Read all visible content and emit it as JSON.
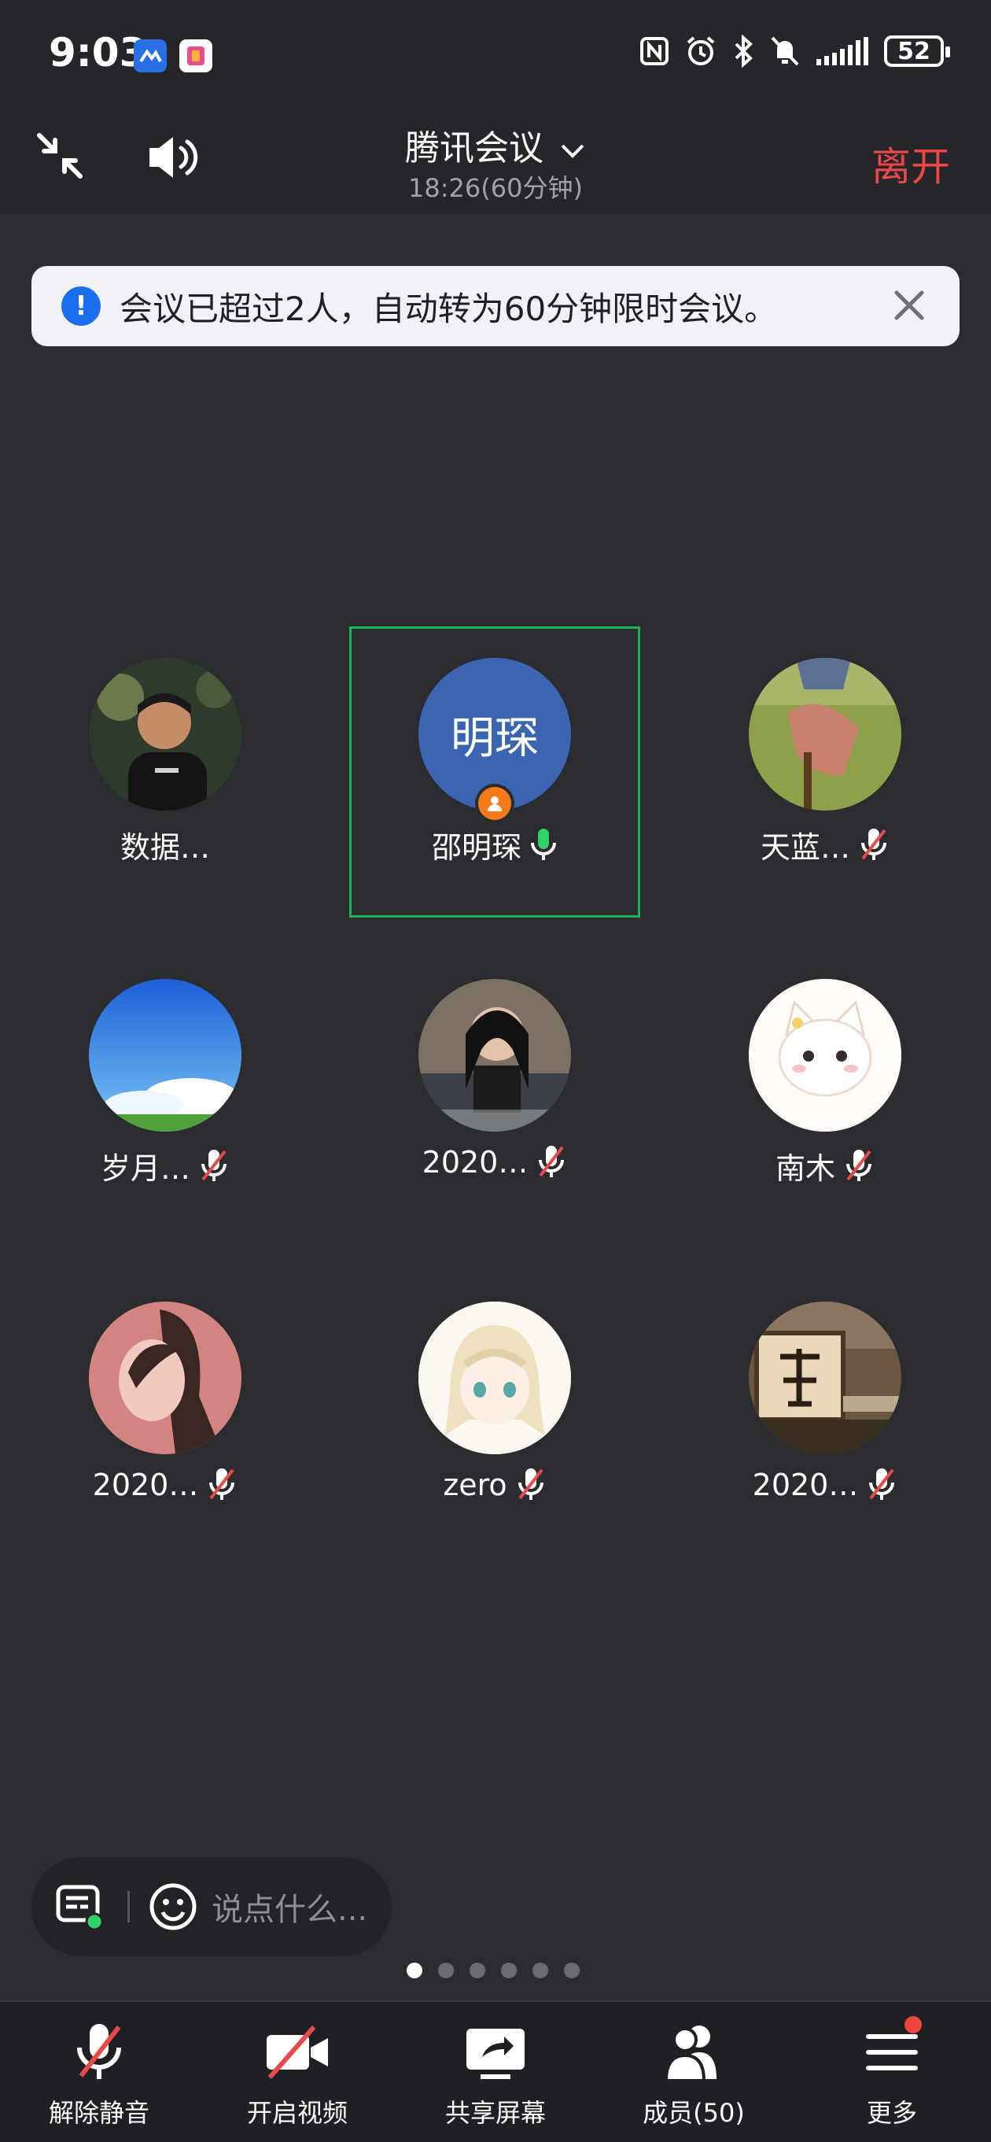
{
  "status_bar": {
    "time": "9:03",
    "battery": "52"
  },
  "header": {
    "title": "腾讯会议",
    "subtitle": "18:26(60分钟)",
    "leave_label": "离开"
  },
  "notice": {
    "text": "会议已超过2人，自动转为60分钟限时会议。"
  },
  "participants": [
    {
      "name": "数据…",
      "mic": "none"
    },
    {
      "name": "邵明琛",
      "mic": "on",
      "avatar_text": "明琛",
      "speaking": true
    },
    {
      "name": "天蓝…",
      "mic": "muted"
    },
    {
      "name": "岁月…",
      "mic": "muted"
    },
    {
      "name": "2020…",
      "mic": "muted"
    },
    {
      "name": "南木",
      "mic": "muted"
    },
    {
      "name": "2020…",
      "mic": "muted"
    },
    {
      "name": "zero",
      "mic": "muted"
    },
    {
      "name": "2020…",
      "mic": "muted"
    }
  ],
  "chat": {
    "placeholder": "说点什么..."
  },
  "toolbar": {
    "unmute_label": "解除静音",
    "video_label": "开启视频",
    "share_label": "共享屏幕",
    "members_label": "成员(50)",
    "more_label": "更多"
  },
  "colors": {
    "leave": "#ec4747",
    "speaking_border": "#1fb257",
    "mic_active": "#2fd36a",
    "host_badge": "#f57a1b",
    "info_blue": "#1a6ff0"
  }
}
